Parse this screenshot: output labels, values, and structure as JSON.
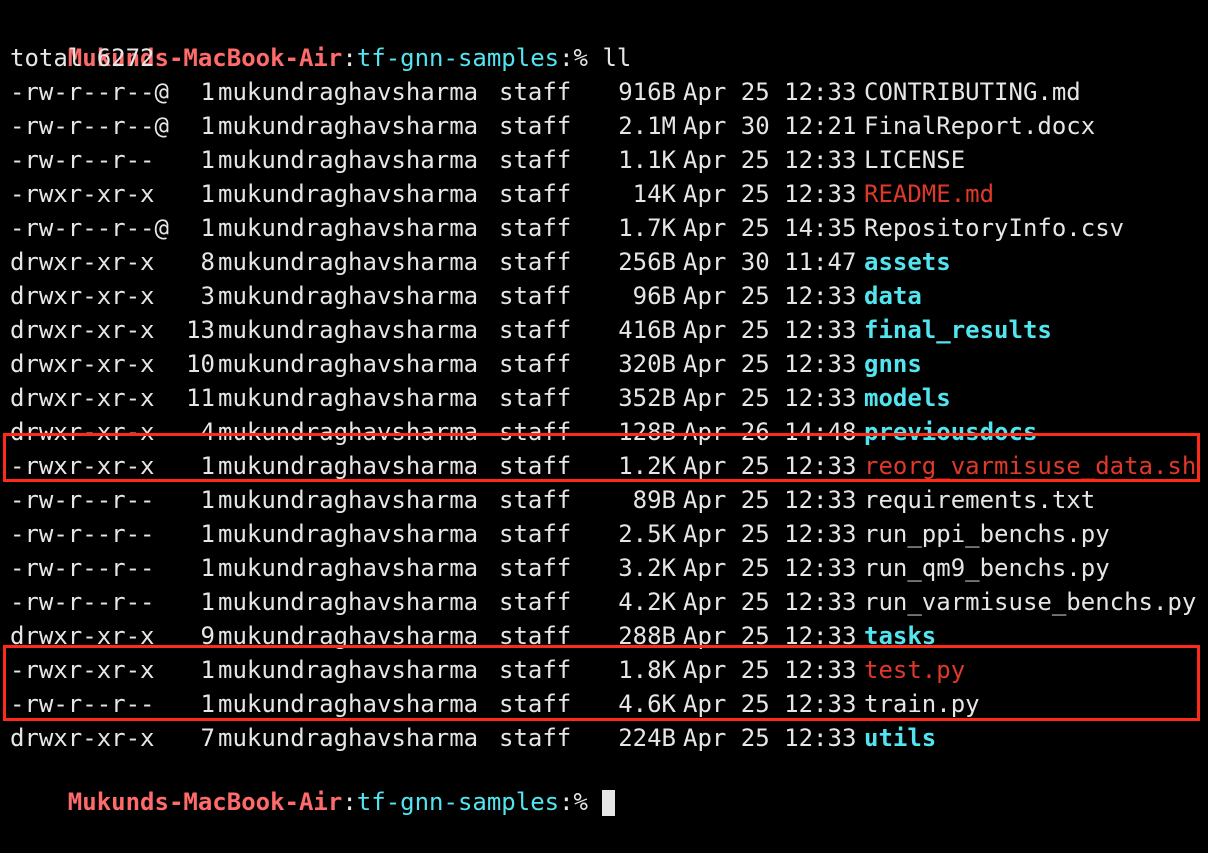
{
  "prompt": {
    "host": "Mukunds-MacBook-Air",
    "dir": "tf-gnn-samples",
    "suffix": "% ",
    "command": "ll"
  },
  "total": "total 6272",
  "listing": [
    {
      "perm": "-rw-r--r--@",
      "links": "1",
      "owner": "mukundraghavsharma",
      "group": "staff",
      "size": "916B",
      "date": "Apr 25 12:33",
      "name": "CONTRIBUTING.md",
      "kind": "plain"
    },
    {
      "perm": "-rw-r--r--@",
      "links": "1",
      "owner": "mukundraghavsharma",
      "group": "staff",
      "size": "2.1M",
      "date": "Apr 30 12:21",
      "name": "FinalReport.docx",
      "kind": "plain"
    },
    {
      "perm": "-rw-r--r--",
      "links": "1",
      "owner": "mukundraghavsharma",
      "group": "staff",
      "size": "1.1K",
      "date": "Apr 25 12:33",
      "name": "LICENSE",
      "kind": "plain"
    },
    {
      "perm": "-rwxr-xr-x",
      "links": "1",
      "owner": "mukundraghavsharma",
      "group": "staff",
      "size": "14K",
      "date": "Apr 25 12:33",
      "name": "README.md",
      "kind": "exec"
    },
    {
      "perm": "-rw-r--r--@",
      "links": "1",
      "owner": "mukundraghavsharma",
      "group": "staff",
      "size": "1.7K",
      "date": "Apr 25 14:35",
      "name": "RepositoryInfo.csv",
      "kind": "plain"
    },
    {
      "perm": "drwxr-xr-x",
      "links": "8",
      "owner": "mukundraghavsharma",
      "group": "staff",
      "size": "256B",
      "date": "Apr 30 11:47",
      "name": "assets",
      "kind": "dir"
    },
    {
      "perm": "drwxr-xr-x",
      "links": "3",
      "owner": "mukundraghavsharma",
      "group": "staff",
      "size": "96B",
      "date": "Apr 25 12:33",
      "name": "data",
      "kind": "dir"
    },
    {
      "perm": "drwxr-xr-x",
      "links": "13",
      "owner": "mukundraghavsharma",
      "group": "staff",
      "size": "416B",
      "date": "Apr 25 12:33",
      "name": "final_results",
      "kind": "dir"
    },
    {
      "perm": "drwxr-xr-x",
      "links": "10",
      "owner": "mukundraghavsharma",
      "group": "staff",
      "size": "320B",
      "date": "Apr 25 12:33",
      "name": "gnns",
      "kind": "dir"
    },
    {
      "perm": "drwxr-xr-x",
      "links": "11",
      "owner": "mukundraghavsharma",
      "group": "staff",
      "size": "352B",
      "date": "Apr 25 12:33",
      "name": "models",
      "kind": "dir"
    },
    {
      "perm": "drwxr-xr-x",
      "links": "4",
      "owner": "mukundraghavsharma",
      "group": "staff",
      "size": "128B",
      "date": "Apr 26 14:48",
      "name": "previousdocs",
      "kind": "dir"
    },
    {
      "perm": "-rwxr-xr-x",
      "links": "1",
      "owner": "mukundraghavsharma",
      "group": "staff",
      "size": "1.2K",
      "date": "Apr 25 12:33",
      "name": "reorg_varmisuse_data.sh",
      "kind": "exec"
    },
    {
      "perm": "-rw-r--r--",
      "links": "1",
      "owner": "mukundraghavsharma",
      "group": "staff",
      "size": "89B",
      "date": "Apr 25 12:33",
      "name": "requirements.txt",
      "kind": "plain"
    },
    {
      "perm": "-rw-r--r--",
      "links": "1",
      "owner": "mukundraghavsharma",
      "group": "staff",
      "size": "2.5K",
      "date": "Apr 25 12:33",
      "name": "run_ppi_benchs.py",
      "kind": "plain"
    },
    {
      "perm": "-rw-r--r--",
      "links": "1",
      "owner": "mukundraghavsharma",
      "group": "staff",
      "size": "3.2K",
      "date": "Apr 25 12:33",
      "name": "run_qm9_benchs.py",
      "kind": "plain"
    },
    {
      "perm": "-rw-r--r--",
      "links": "1",
      "owner": "mukundraghavsharma",
      "group": "staff",
      "size": "4.2K",
      "date": "Apr 25 12:33",
      "name": "run_varmisuse_benchs.py",
      "kind": "plain"
    },
    {
      "perm": "drwxr-xr-x",
      "links": "9",
      "owner": "mukundraghavsharma",
      "group": "staff",
      "size": "288B",
      "date": "Apr 25 12:33",
      "name": "tasks",
      "kind": "dir"
    },
    {
      "perm": "-rwxr-xr-x",
      "links": "1",
      "owner": "mukundraghavsharma",
      "group": "staff",
      "size": "1.8K",
      "date": "Apr 25 12:33",
      "name": "test.py",
      "kind": "exec"
    },
    {
      "perm": "-rw-r--r--",
      "links": "1",
      "owner": "mukundraghavsharma",
      "group": "staff",
      "size": "4.6K",
      "date": "Apr 25 12:33",
      "name": "train.py",
      "kind": "plain"
    },
    {
      "perm": "drwxr-xr-x",
      "links": "7",
      "owner": "mukundraghavsharma",
      "group": "staff",
      "size": "224B",
      "date": "Apr 25 12:33",
      "name": "utils",
      "kind": "dir"
    }
  ],
  "colors": {
    "background": "#000000",
    "text": "#e6e6e6",
    "directory": "#52e5f0",
    "executable": "#e0382a",
    "prompt_host": "#ff6b6b",
    "highlight": "#ff2a1a"
  }
}
